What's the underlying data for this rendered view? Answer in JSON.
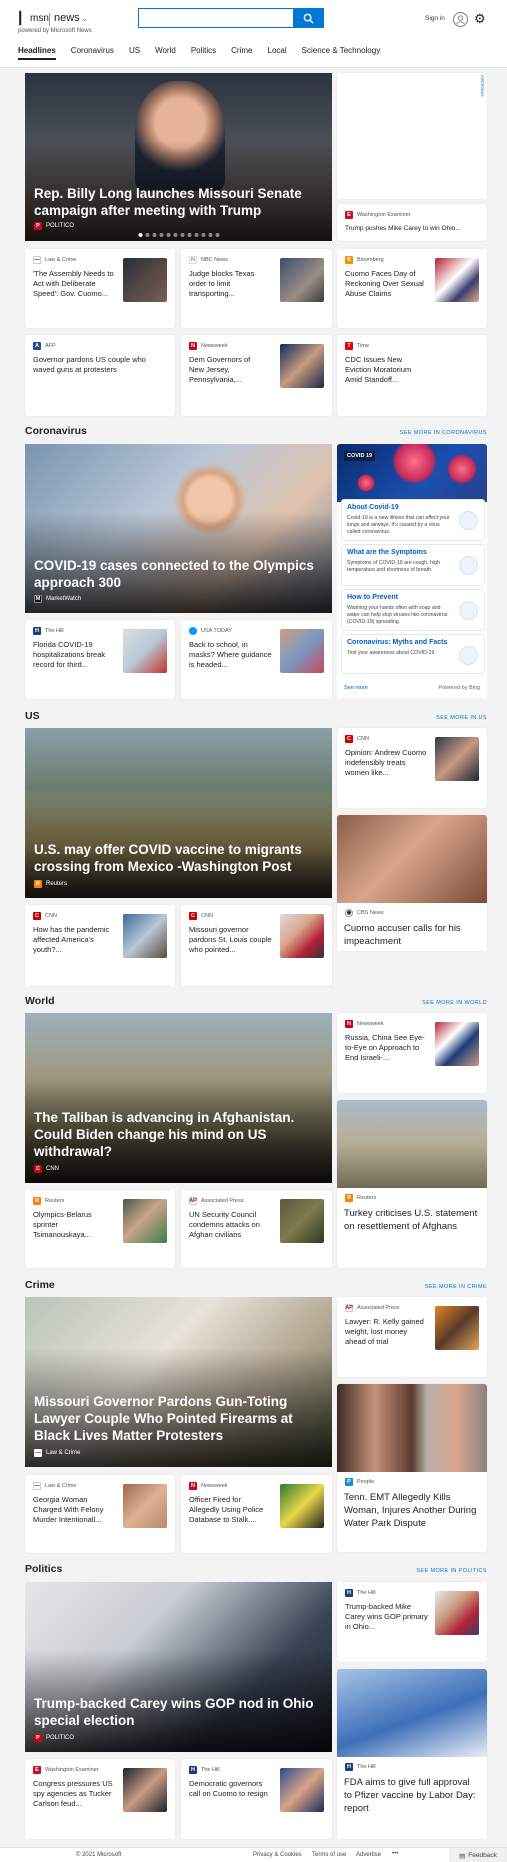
{
  "header": {
    "brand_msn": "msn",
    "brand_news": "news",
    "powered_by": "powered by Microsoft News",
    "search_placeholder": "",
    "signin": "Sign in"
  },
  "nav": [
    "Headlines",
    "Coronavirus",
    "US",
    "World",
    "Politics",
    "Crime",
    "Local",
    "Science & Technology"
  ],
  "ad_label": "AdChoices",
  "headlines": {
    "hero": {
      "title": "Rep. Billy Long launches Missouri Senate campaign after meeting with Trump",
      "source": "POLITICO"
    },
    "side_small": {
      "source": "Washington Examiner",
      "title": "Trump pushes Mike Carey to win Ohio..."
    },
    "cards": [
      {
        "source": "Law & Crime",
        "title": "'The Assembly Needs to Act with Deliberate Speed': Gov. Cuomo..."
      },
      {
        "source": "NBC News",
        "title": "Judge blocks Texas order to limit transporting..."
      },
      {
        "source": "Bloomberg",
        "title": "Cuomo Faces Day of Reckoning Over Sexual Abuse Claims"
      },
      {
        "source": "AFP",
        "title": "Governor pardons US couple who waved guns at protesters"
      },
      {
        "source": "Newsweek",
        "title": "Dem Governors of New Jersey, Pennsylvania,..."
      },
      {
        "source": "Time",
        "title": "CDC Issues New Eviction Moratorium Amid Standoff..."
      }
    ]
  },
  "coronavirus": {
    "heading": "Coronavirus",
    "see_more": "SEE MORE IN CORONAVIRUS",
    "hero": {
      "title": "COVID-19 cases connected to the Olympics approach 300",
      "source": "MarketWatch"
    },
    "cards": [
      {
        "source": "The Hill",
        "title": "Florida COVID-19 hospitalizations break record for third..."
      },
      {
        "source": "USA TODAY",
        "title": "Back to school, in masks? Where guidance is headed..."
      }
    ],
    "panel": {
      "badge": "COVID 19",
      "items": [
        {
          "heading": "About Covid-19",
          "body": "Covid-19 is a new illness that can affect your lungs and airways. It's caused by a virus called coronavirus."
        },
        {
          "heading": "What are the Symptoms",
          "body": "Symptoms of COVID-19 are cough, high temperature and shortness of breath."
        },
        {
          "heading": "How to Prevent",
          "body": "Washing your hands often with soap and water can help stop viruses like coronavirus (COVID-19) spreading."
        },
        {
          "heading": "Coronavirus: Myths and Facts",
          "body": "Test your awareness about COVID-19."
        }
      ],
      "see_more": "See more",
      "powered": "Powered by Bing"
    }
  },
  "us": {
    "heading": "US",
    "see_more": "SEE MORE IN US",
    "hero": {
      "title": "U.S. may offer COVID vaccine to migrants crossing from Mexico -Washington Post",
      "source": "Reuters"
    },
    "side_top": {
      "source": "CNN",
      "title": "Opinion: Andrew Cuomo indefensibly treats women like..."
    },
    "side_big": {
      "source": "CBS News",
      "title": "Cuomo accuser calls for his impeachment"
    },
    "cards": [
      {
        "source": "CNN",
        "title": "How has the pandemic affected America's youth?..."
      },
      {
        "source": "CNN",
        "title": "Missouri governor pardons St. Louis couple who pointed..."
      }
    ]
  },
  "world": {
    "heading": "World",
    "see_more": "SEE MORE IN WORLD",
    "hero": {
      "title": "The Taliban is advancing in Afghanistan. Could Biden change his mind on US withdrawal?",
      "source": "CNN"
    },
    "side_top": {
      "source": "Newsweek",
      "title": "Russia, China See Eye-to-Eye on Approach to End Israeli-..."
    },
    "side_big": {
      "source": "Reuters",
      "title": "Turkey criticises U.S. statement on resettlement of Afghans"
    },
    "cards": [
      {
        "source": "Reuters",
        "title": "Olympics-Belarus sprinter Tsimanouskaya..."
      },
      {
        "source": "Associated Press",
        "title": "UN Security Council condemns attacks on Afghan civilians"
      }
    ]
  },
  "crime": {
    "heading": "Crime",
    "see_more": "SEE MORE IN CRIME",
    "hero": {
      "title": "Missouri Governor Pardons Gun-Toting Lawyer Couple Who Pointed Firearms at Black Lives Matter Protesters",
      "source": "Law & Crime"
    },
    "side_top": {
      "source": "Associated Press",
      "title": "Lawyer: R. Kelly gained weight, lost money ahead of trial"
    },
    "side_big": {
      "source": "People",
      "title": "Tenn. EMT Allegedly Kills Woman, Injures Another During Water Park Dispute"
    },
    "cards": [
      {
        "source": "Law & Crime",
        "title": "Georgia Woman Charged With Felony Murder Intentionall..."
      },
      {
        "source": "Newsweek",
        "title": "Officer Fired for Allegedly Using Police Database to Stalk,..."
      }
    ]
  },
  "politics": {
    "heading": "Politics",
    "see_more": "SEE MORE IN POLITICS",
    "hero": {
      "title": "Trump-backed Carey wins GOP nod in Ohio special election",
      "source": "POLITICO"
    },
    "side_top": {
      "source": "The Hill",
      "title": "Trump-backed Mike Carey wins GOP primary in Ohio..."
    },
    "side_big": {
      "source": "The Hill",
      "title": "FDA aims to give full approval to Pfizer vaccine by Labor Day: report"
    },
    "cards": [
      {
        "source": "Washington Examiner",
        "title": "Congress pressures US spy agencies as Tucker Carlson feud..."
      },
      {
        "source": "The Hill",
        "title": "Democratic governors call on Cuomo to resign"
      }
    ]
  },
  "footer": {
    "copyright": "© 2021 Microsoft",
    "links": [
      "Privacy & Cookies",
      "Terms of use",
      "Advertise"
    ],
    "more": "•••",
    "feedback": "Feedback"
  }
}
